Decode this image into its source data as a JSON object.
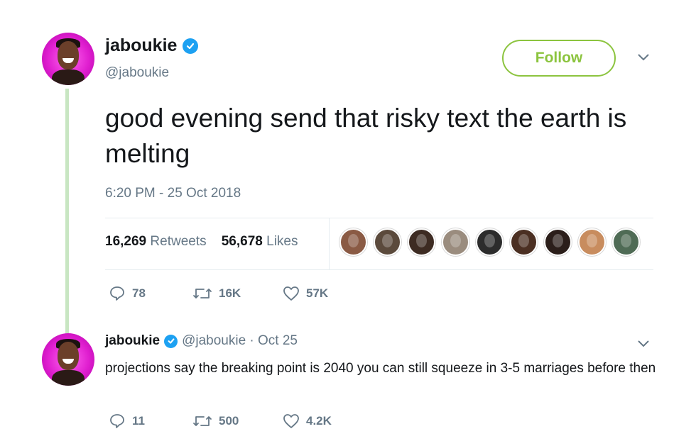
{
  "main_tweet": {
    "display_name": "jaboukie",
    "handle": "@jaboukie",
    "follow_label": "Follow",
    "text": "good evening send that risky text the earth is melting",
    "timestamp": "6:20 PM - 25 Oct 2018",
    "retweets_count": "16,269",
    "retweets_label": "Retweets",
    "likes_count": "56,678",
    "likes_label": "Likes",
    "liker_avatar_colors": [
      "#8a5a44",
      "#5b4a3c",
      "#3d2b22",
      "#9a8c7e",
      "#2c2c2c",
      "#4b2f22",
      "#2b1e1a",
      "#c88c5e",
      "#4f6b55"
    ],
    "actions": {
      "replies": "78",
      "retweets": "16K",
      "likes": "57K"
    }
  },
  "reply_tweet": {
    "display_name": "jaboukie",
    "handle_date": "@jaboukie · Oct 25",
    "text": "projections say the breaking point is 2040 you can still squeeze in 3-5 marriages before then",
    "actions": {
      "replies": "11",
      "retweets": "500",
      "likes": "4.2K"
    }
  },
  "colors": {
    "follow_accent": "#8cc43f",
    "verified_blue": "#1da1f2",
    "muted_text": "#657786",
    "thread_line": "#c8e6c2",
    "avatar_bg": "#e01fd0"
  },
  "icons": [
    "verified-badge-icon",
    "chevron-down-icon",
    "reply-icon",
    "retweet-icon",
    "like-heart-icon"
  ]
}
